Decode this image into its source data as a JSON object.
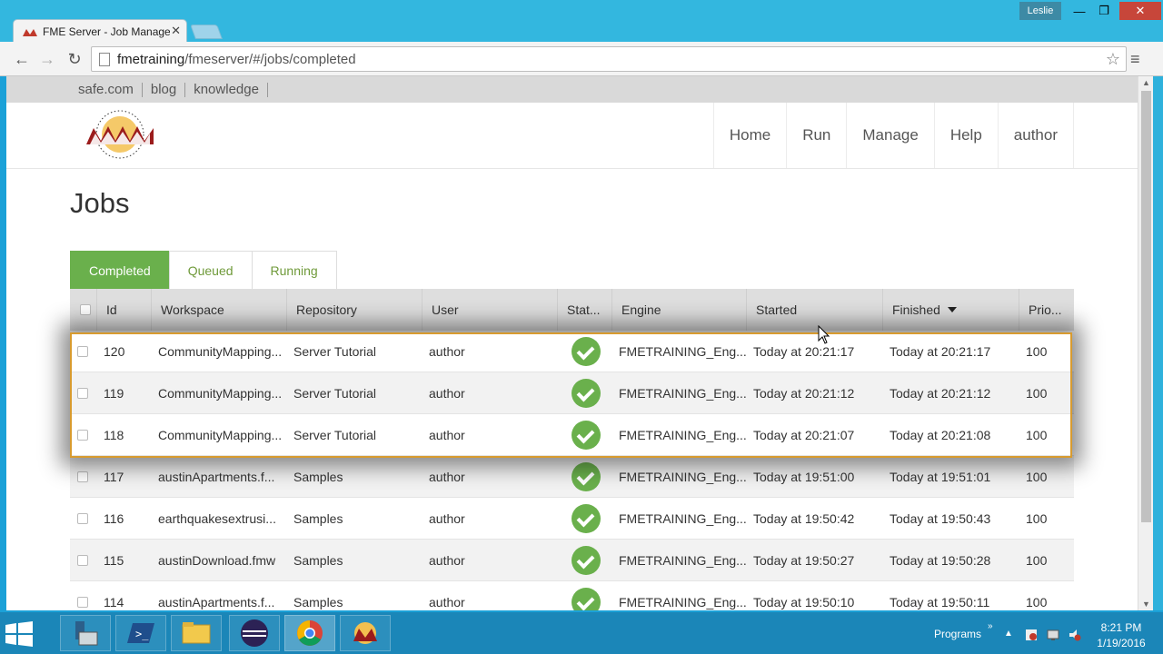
{
  "browser": {
    "tab_title": "FME Server - Job Manage",
    "url_host": "fmetraining",
    "url_path": "/fmeserver/#/jobs/completed",
    "user_badge": "Leslie",
    "window_controls": {
      "min": "—",
      "max": "❐",
      "close": "✕"
    }
  },
  "topbar": {
    "links": [
      "safe.com",
      "blog",
      "knowledge"
    ]
  },
  "nav": {
    "items": [
      "Home",
      "Run",
      "Manage",
      "Help",
      "author"
    ]
  },
  "page": {
    "title": "Jobs"
  },
  "tabs": [
    {
      "label": "Completed",
      "active": true
    },
    {
      "label": "Queued",
      "active": false
    },
    {
      "label": "Running",
      "active": false
    }
  ],
  "table": {
    "columns": [
      "Id",
      "Workspace",
      "Repository",
      "User",
      "Stat...",
      "Engine",
      "Started",
      "Finished",
      "Prio..."
    ],
    "sort_column": "Finished",
    "sort_direction": "desc",
    "rows": [
      {
        "id": "120",
        "workspace": "CommunityMapping...",
        "repository": "Server Tutorial",
        "user": "author",
        "status": "success",
        "engine": "FMETRAINING_Eng...",
        "started": "Today at 20:21:17",
        "finished": "Today at 20:21:17",
        "priority": "100"
      },
      {
        "id": "119",
        "workspace": "CommunityMapping...",
        "repository": "Server Tutorial",
        "user": "author",
        "status": "success",
        "engine": "FMETRAINING_Eng...",
        "started": "Today at 20:21:12",
        "finished": "Today at 20:21:12",
        "priority": "100"
      },
      {
        "id": "118",
        "workspace": "CommunityMapping...",
        "repository": "Server Tutorial",
        "user": "author",
        "status": "success",
        "engine": "FMETRAINING_Eng...",
        "started": "Today at 20:21:07",
        "finished": "Today at 20:21:08",
        "priority": "100"
      },
      {
        "id": "117",
        "workspace": "austinApartments.f...",
        "repository": "Samples",
        "user": "author",
        "status": "success",
        "engine": "FMETRAINING_Eng...",
        "started": "Today at 19:51:00",
        "finished": "Today at 19:51:01",
        "priority": "100"
      },
      {
        "id": "116",
        "workspace": "earthquakesextrusi...",
        "repository": "Samples",
        "user": "author",
        "status": "success",
        "engine": "FMETRAINING_Eng...",
        "started": "Today at 19:50:42",
        "finished": "Today at 19:50:43",
        "priority": "100"
      },
      {
        "id": "115",
        "workspace": "austinDownload.fmw",
        "repository": "Samples",
        "user": "author",
        "status": "success",
        "engine": "FMETRAINING_Eng...",
        "started": "Today at 19:50:27",
        "finished": "Today at 19:50:28",
        "priority": "100"
      },
      {
        "id": "114",
        "workspace": "austinApartments.f...",
        "repository": "Samples",
        "user": "author",
        "status": "success",
        "engine": "FMETRAINING_Eng...",
        "started": "Today at 19:50:10",
        "finished": "Today at 19:50:11",
        "priority": "100"
      }
    ]
  },
  "taskbar": {
    "tray_label": "Programs",
    "time": "8:21 PM",
    "date": "1/19/2016"
  },
  "colors": {
    "accent_green": "#6ab04c",
    "highlight_border": "#d89b2f",
    "taskbar": "#1b86b8",
    "titlebar": "#33b7df"
  }
}
